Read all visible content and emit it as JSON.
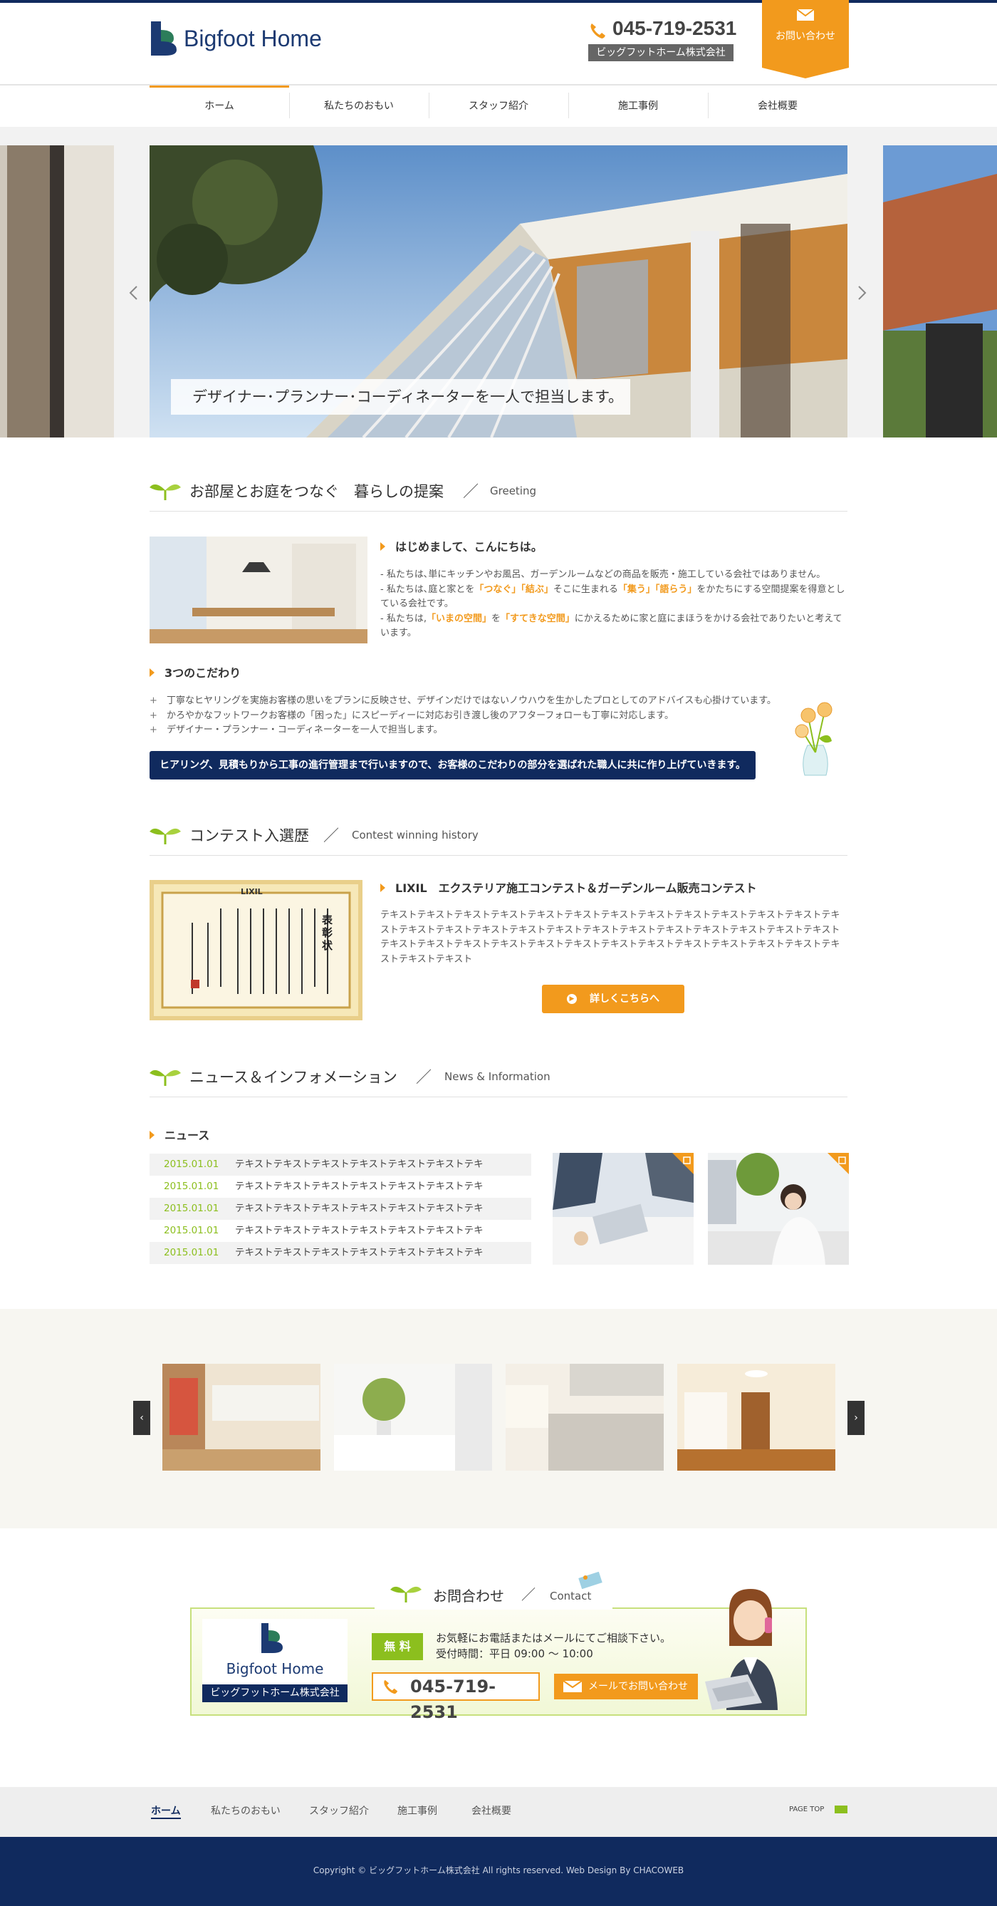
{
  "header": {
    "logo_text": "Bigfoot Home",
    "tel": "045-719-2531",
    "company": "ビッグフットホーム株式会社",
    "contact_tab": "お問い合わせ"
  },
  "nav": {
    "items": [
      {
        "label": "ホーム",
        "active": true
      },
      {
        "label": "私たちのおもい"
      },
      {
        "label": "スタッフ紹介"
      },
      {
        "label": "施工事例"
      },
      {
        "label": "会社概要"
      }
    ]
  },
  "slider": {
    "caption": "デザイナー･プランナー･コーディネーターを一人で担当します。"
  },
  "greeting": {
    "title": "お部屋とお庭をつなぐ　暮らしの提案",
    "title_en": "Greeting",
    "heading": "はじめまして、こんにちは。",
    "line1": "- 私たちは､単にキッチンやお風呂、ガーデンルームなどの商品を販売・施工している会社ではありません。",
    "line2_a": "- 私たちは､庭と家とを",
    "line2_hl1": "「つなぐ」",
    "line2_hl2": "「結ぶ」",
    "line2_b": "そこに生まれる",
    "line2_hl3": "「集う」",
    "line2_hl4": "「語らう」",
    "line2_c": "をかたちにする空間提案を得意としている会社です。",
    "line3_a": "- 私たちは,",
    "line3_hl1": "「いまの空間」",
    "line3_b": "を",
    "line3_hl2": "「すてきな空間」",
    "line3_c": "にかえるために家と庭にまほうをかける会社でありたいと考えています。",
    "kodawari_title": "3つのこだわり",
    "kodawari": [
      "丁寧なヒヤリングを実施お客様の思いをプランに反映させ、デザインだけではないノウハウを生かしたプロとしてのアドバイスも心掛けています。",
      "かろやかなフットワークお客様の「困った」にスピーディーに対応お引き渡し後のアフターフォローも丁寧に対応します。",
      "デザイナー・プランナー・コーディネーターを一人で担当します。"
    ],
    "kodawari_marker": "+",
    "banner": "ヒアリング、見積もりから工事の進行管理まで行いますので、お客様のこだわりの部分を選ばれた職人に共に作り上げていきます。"
  },
  "contest": {
    "title": "コンテスト入選歴",
    "title_en": "Contest winning history",
    "heading": "LIXIL　エクステリア施工コンテスト＆ガーデンルーム販売コンテスト",
    "body": "テキストテキストテキストテキストテキストテキストテキストテキストテキストテキストテキストテキストテキストテキストテキストテキストテキストテキストテキストテキストテキストテキストテキストテキストテキストテキストテキストテキストテキストテキストテキストテキストテキストテキストテキストテキストテキストテキストテキストテキスト",
    "button": "詳しくこちらへ",
    "award_label": "LIXIL",
    "award_title": "表彰状"
  },
  "news": {
    "title": "ニュース＆インフォメーション",
    "title_en": "News & Information",
    "label": "ニュース",
    "items": [
      {
        "date": "2015.01.01",
        "text": "テキストテキストテキストテキストテキストテキストテキ"
      },
      {
        "date": "2015.01.01",
        "text": "テキストテキストテキストテキストテキストテキストテキ"
      },
      {
        "date": "2015.01.01",
        "text": "テキストテキストテキストテキストテキストテキストテキ"
      },
      {
        "date": "2015.01.01",
        "text": "テキストテキストテキストテキストテキストテキストテキ"
      },
      {
        "date": "2015.01.01",
        "text": "テキストテキストテキストテキストテキストテキストテキ"
      }
    ]
  },
  "contact": {
    "title": "お問合わせ",
    "title_en": "Contact",
    "logo_text": "Bigfoot Home",
    "company": "ビッグフットホーム株式会社",
    "free": "無 料",
    "msg1": "お気軽にお電話またはメールにてご相談下さい。",
    "msg2": "受付時間：平日 09:00 ～ 10:00",
    "tel": "045-719-2531",
    "mail_button": "メールでお問い合わせ"
  },
  "footer": {
    "nav": [
      "ホーム",
      "私たちのおもい",
      "スタッフ紹介",
      "施工事例",
      "会社概要"
    ],
    "page_top": "PAGE TOP",
    "copyright": "Copyright © ビッグフットホーム株式会社 All rights reserved. Web Design By CHACOWEB"
  },
  "colors": {
    "navy": "#102a5e",
    "orange": "#f29a1d",
    "green": "#8cbf1e"
  }
}
